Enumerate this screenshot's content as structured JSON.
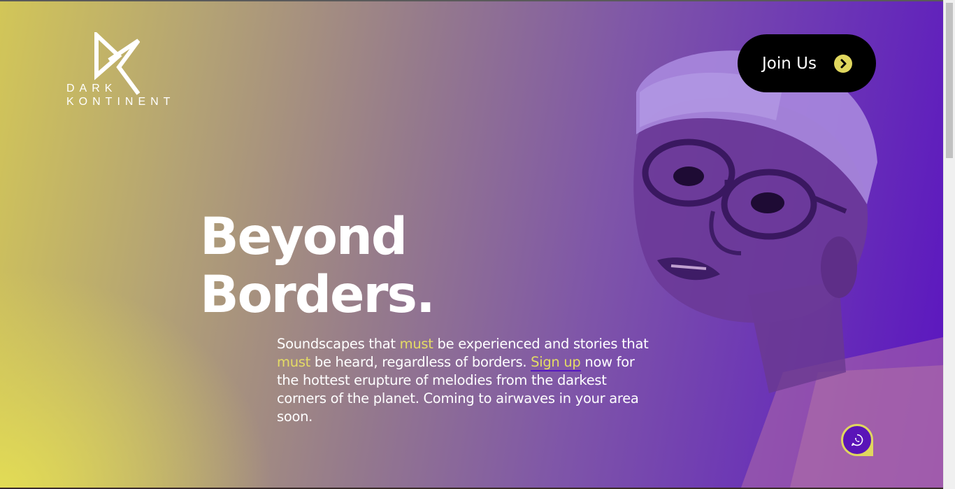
{
  "brand": {
    "line1": "DARK",
    "line2": "KONTINENT",
    "logo_icon": "dk-monogram-icon"
  },
  "header": {
    "join_label": "Join Us",
    "join_icon": "chevron-circle-right-icon"
  },
  "hero": {
    "headline_line1": "Beyond",
    "headline_line2": "Borders.",
    "body": {
      "part1": "Soundscapes that ",
      "must1": "must",
      "part2": " be experienced and stories that ",
      "must2": "must",
      "part3": " be heard, regardless of borders. ",
      "signup": "Sign up",
      "part4": " now for the hottest erupture of melodies from the darkest corners of the planet. Coming to airwaves in your area soon."
    }
  },
  "chat": {
    "icon": "whatsapp-icon"
  },
  "colors": {
    "accent_yellow": "#e4dc64",
    "accent_purple": "#5a14c0",
    "button_black": "#000000"
  }
}
